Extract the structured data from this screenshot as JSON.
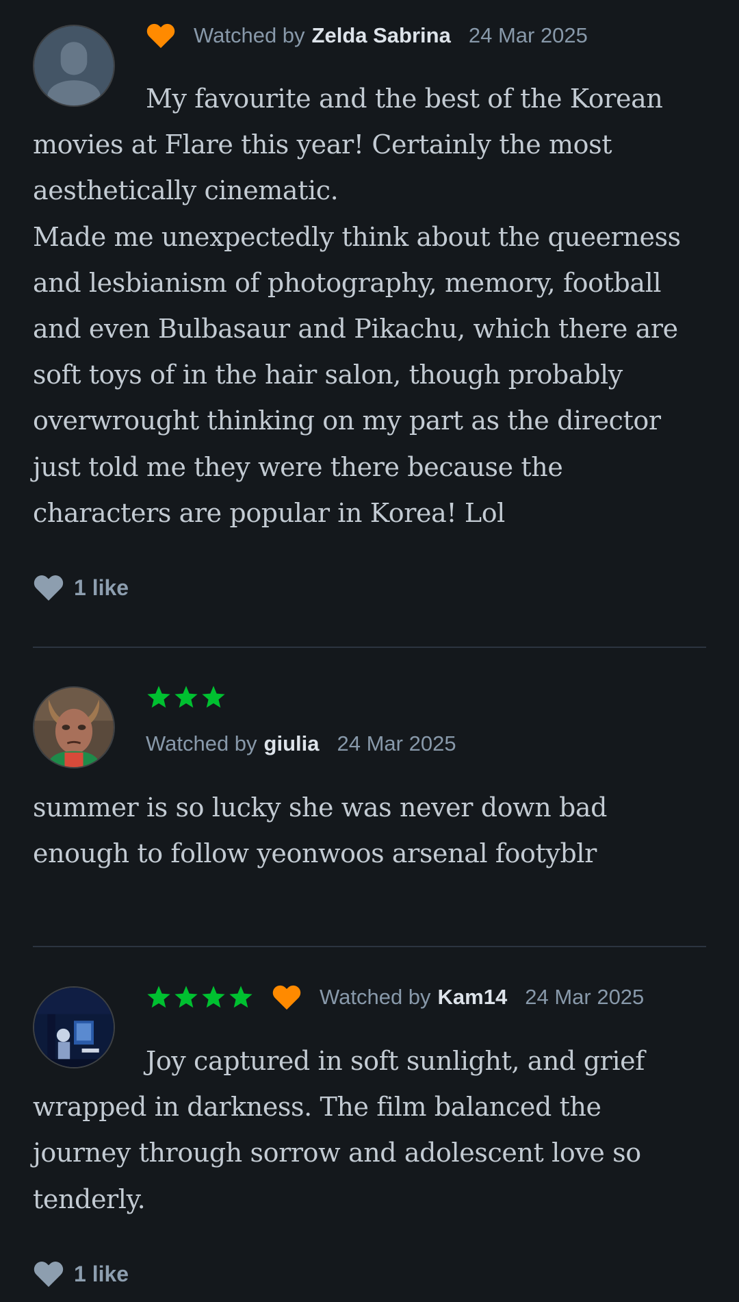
{
  "colors": {
    "background": "#14181c",
    "star": "#00c030",
    "liked_heart": "#ff8a00",
    "divider": "#2c3440"
  },
  "reviews": [
    {
      "author": "Zelda Sabrina",
      "watched_by_label": "Watched by",
      "date": "24 Mar 2025",
      "stars": 0,
      "liked": true,
      "avatar_icon": "default-person-avatar",
      "lines": [
        "My favourite and the best of the Korean",
        "movies at Flare this year! Certainly the most",
        "aesthetically cinematic.",
        "Made me unexpectedly think about the queerness",
        "and lesbianism of photography, memory, football",
        "and even Bulbasaur and Pikachu, which there are",
        "soft toys of in the hair salon, though probably",
        "overwrought thinking on my part as the director",
        "just told me they were there because the",
        "characters are popular in Korea! Lol"
      ],
      "likes": "1 like"
    },
    {
      "author": "giulia",
      "watched_by_label": "Watched by",
      "date": "24 Mar 2025",
      "stars": 3,
      "liked": false,
      "avatar_icon": "costumed-face-avatar",
      "lines": [
        "summer is so lucky she was never down bad",
        "enough to follow yeonwoos arsenal footyblr"
      ],
      "likes": ""
    },
    {
      "author": "Kam14",
      "watched_by_label": "Watched by",
      "date": "24 Mar 2025",
      "stars": 4,
      "liked": true,
      "avatar_icon": "blue-night-scene-avatar",
      "lines": [
        "Joy captured in soft sunlight, and grief",
        "wrapped in darkness. The film balanced the",
        "journey through sorrow and adolescent love so",
        "tenderly."
      ],
      "likes": "1 like"
    }
  ]
}
